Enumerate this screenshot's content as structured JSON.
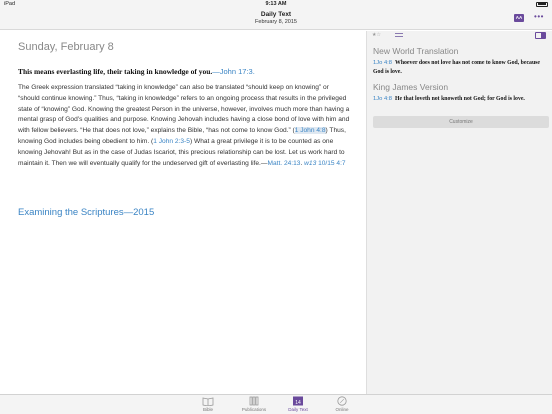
{
  "status_bar": {
    "carrier": "iPad",
    "time": "9:13 AM",
    "battery": ""
  },
  "header": {
    "title": "Daily Text",
    "subtitle": "February 8, 2015",
    "font_button_label": "AA",
    "more_button_label": "•••"
  },
  "article": {
    "date": "Sunday, February 8",
    "theme": "This means everlasting life, their taking in knowledge of you.",
    "theme_ref": "—John 17:3.",
    "comment_segments": [
      {
        "type": "text",
        "text": "The Greek expression translated “taking in knowledge” can also be translated “should keep on knowing” or “should continue knowing.” Thus, “taking in knowledge” refers to an ongoing process that results in the privileged state of “knowing” God. Knowing the greatest Person in the universe, however, involves much more than having a mental grasp of God’s qualities and purpose. Knowing Jehovah includes having a close bond of love with him and with fellow believers. “He that does not love,” explains the Bible, “has not come to know God.” ("
      },
      {
        "type": "link-hl",
        "text": "1 John 4:8"
      },
      {
        "type": "text",
        "text": ") Thus, knowing God includes being obedient to him. ("
      },
      {
        "type": "link",
        "text": "1 John 2:3-5"
      },
      {
        "type": "text",
        "text": ") What a great privilege it is to be counted as one knowing Jehovah! But as in the case of Judas Iscariot, this precious relationship can be lost. Let us work hard to maintain it. Then we will eventually qualify for the undeserved gift of everlasting life.—"
      },
      {
        "type": "link",
        "text": "Matt. 24:13"
      },
      {
        "type": "text",
        "text": ". "
      },
      {
        "type": "pub",
        "text": "w13"
      },
      {
        "type": "link",
        "text": " 10/15 4:7"
      }
    ],
    "source_link": "Examining the Scriptures—2015"
  },
  "side_panel": {
    "translations": [
      {
        "name": "New World Translation",
        "ref": "1Jo 4:8",
        "text": "Whoever does not love has not come to know God, because God is love."
      },
      {
        "name": "King James Version",
        "ref": "1Jo 4:8",
        "text": "He that loveth not knoweth not God; for God is love."
      }
    ],
    "customize_label": "Customize"
  },
  "tabs": [
    {
      "label": "Bible",
      "icon": "book-icon",
      "active": false
    },
    {
      "label": "Publications",
      "icon": "library-icon",
      "active": false
    },
    {
      "label": "Daily Text",
      "icon": "calendar-icon",
      "active": true,
      "icon_text": "14"
    },
    {
      "label": "Online",
      "icon": "compass-icon",
      "active": false
    }
  ],
  "colors": {
    "accent": "#6a4a9c",
    "link": "#3a84c4"
  }
}
